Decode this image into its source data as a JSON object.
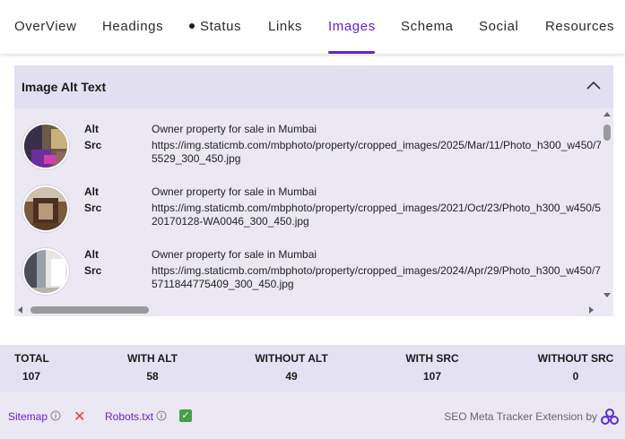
{
  "tabs": [
    {
      "label": "OverView"
    },
    {
      "label": "Headings"
    },
    {
      "label": "Status"
    },
    {
      "label": "Links"
    },
    {
      "label": "Images",
      "active": true
    },
    {
      "label": "Schema"
    },
    {
      "label": "Social"
    },
    {
      "label": "Resources"
    }
  ],
  "panel": {
    "title": "Image Alt Text",
    "alt_label": "Alt",
    "src_label": "Src",
    "items": [
      {
        "alt": "Owner property for sale in Mumbai",
        "src_line1": "https://img.staticmb.com/mbphoto/property/cropped_images/2025/Mar/11/Photo_h300_w450/7",
        "src_line2": "5529_300_450.jpg"
      },
      {
        "alt": "Owner property for sale in Mumbai",
        "src_line1": "https://img.staticmb.com/mbphoto/property/cropped_images/2021/Oct/23/Photo_h300_w450/5",
        "src_line2": "20170128-WA0046_300_450.jpg"
      },
      {
        "alt": "Owner property for sale in Mumbai",
        "src_line1": "https://img.staticmb.com/mbphoto/property/cropped_images/2024/Apr/29/Photo_h300_w450/7",
        "src_line2": "5711844775409_300_450.jpg"
      }
    ]
  },
  "stats": {
    "total": {
      "label": "TOTAL",
      "value": "107"
    },
    "with_alt": {
      "label": "WITH ALT",
      "value": "58"
    },
    "without_alt": {
      "label": "WITHOUT ALT",
      "value": "49"
    },
    "with_src": {
      "label": "WITH SRC",
      "value": "107"
    },
    "without_src": {
      "label": "WITHOUT SRC",
      "value": "0"
    }
  },
  "footer": {
    "sitemap": "Sitemap",
    "sitemap_status": "✕",
    "robots": "Robots.txt",
    "robots_status": "✓",
    "brand": "SEO Meta Tracker Extension by"
  },
  "colors": {
    "accent": "#6a1fd0",
    "error": "#e53935",
    "success": "#43a047"
  }
}
